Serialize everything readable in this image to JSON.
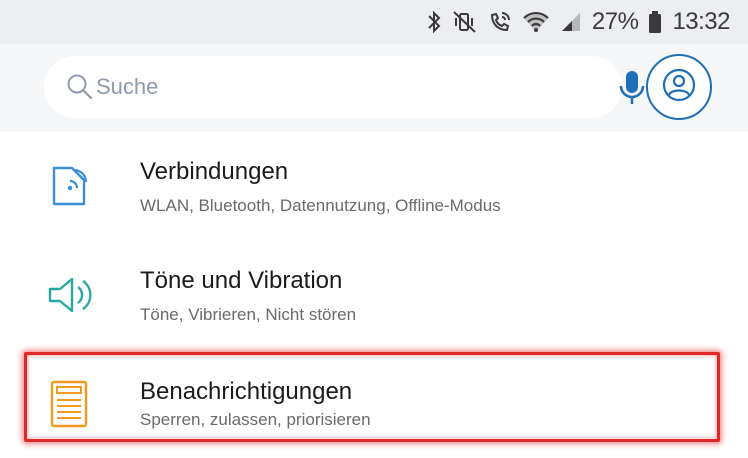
{
  "status_bar": {
    "battery_percent": "27%",
    "time": "13:32",
    "icons": [
      "bluetooth-icon",
      "mute-vibrate-icon",
      "wifi-call-icon",
      "wifi-icon",
      "signal-icon",
      "battery-icon"
    ]
  },
  "search": {
    "placeholder": "Suche"
  },
  "colors": {
    "accent_blue": "#1f6fb8",
    "icon_blue": "#3b8fd6",
    "icon_teal": "#28a8a0",
    "icon_orange": "#f29a1f",
    "highlight_red": "#e02a2a"
  },
  "settings": {
    "items": [
      {
        "title": "Verbindungen",
        "subtitle": "WLAN, Bluetooth, Datennutzung, Offline-Modus",
        "icon": "connections-icon"
      },
      {
        "title": "Töne und Vibration",
        "subtitle": "Töne, Vibrieren, Nicht stören",
        "icon": "speaker-icon"
      },
      {
        "title": "Benachrichtigungen",
        "subtitle": "Sperren, zulassen, priorisieren",
        "icon": "notifications-icon"
      }
    ]
  }
}
